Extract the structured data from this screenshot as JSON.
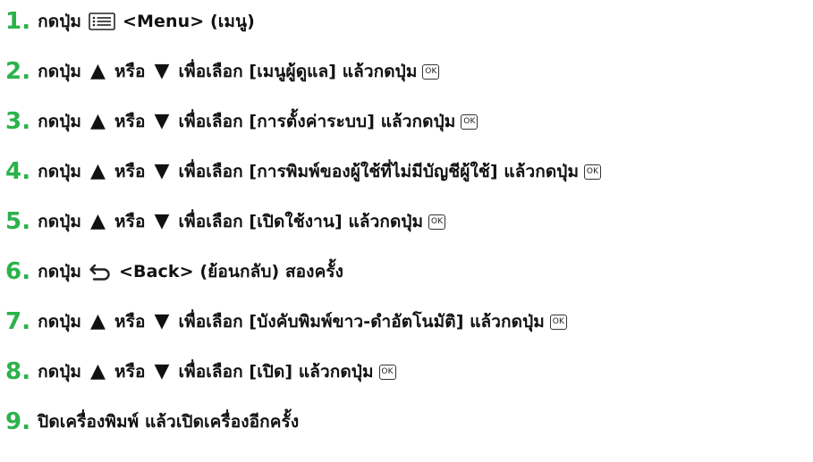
{
  "colors": {
    "step_number": "#2bb24c",
    "text": "#111111"
  },
  "icons": {
    "menu": "menu-list-icon",
    "up": "triangle-up-icon",
    "down": "triangle-down-icon",
    "ok": "ok-button-icon",
    "back": "back-arrow-icon"
  },
  "ok_label": "OK",
  "up_glyph": "▲",
  "down_glyph": "▼",
  "steps": [
    {
      "number": "1.",
      "before": "กดปุ่ม",
      "after": "<Menu> (เมนู)"
    },
    {
      "number": "2.",
      "before": "กดปุ่ม",
      "or": "หรือ",
      "action": "เพื่อเลือก [เมนูผู้ดูแล] แล้วกดปุ่ม"
    },
    {
      "number": "3.",
      "before": "กดปุ่ม",
      "or": "หรือ",
      "action": "เพื่อเลือก [การตั้งค่าระบบ] แล้วกดปุ่ม"
    },
    {
      "number": "4.",
      "before": "กดปุ่ม",
      "or": "หรือ",
      "action": "เพื่อเลือก [การพิมพ์ของผู้ใช้ที่ไม่มีบัญชีผู้ใช้] แล้วกดปุ่ม"
    },
    {
      "number": "5.",
      "before": "กดปุ่ม",
      "or": "หรือ",
      "action": "เพื่อเลือก [เปิดใช้งาน] แล้วกดปุ่ม"
    },
    {
      "number": "6.",
      "before": "กดปุ่ม",
      "after": "<Back> (ย้อนกลับ) สองครั้ง"
    },
    {
      "number": "7.",
      "before": "กดปุ่ม",
      "or": "หรือ",
      "action": "เพื่อเลือก [บังคับพิมพ์ขาว-ดำอัตโนมัติ] แล้วกดปุ่ม"
    },
    {
      "number": "8.",
      "before": "กดปุ่ม",
      "or": "หรือ",
      "action": "เพื่อเลือก [เปิด] แล้วกดปุ่ม"
    },
    {
      "number": "9.",
      "text": "ปิดเครื่องพิมพ์ แล้วเปิดเครื่องอีกครั้ง"
    }
  ]
}
